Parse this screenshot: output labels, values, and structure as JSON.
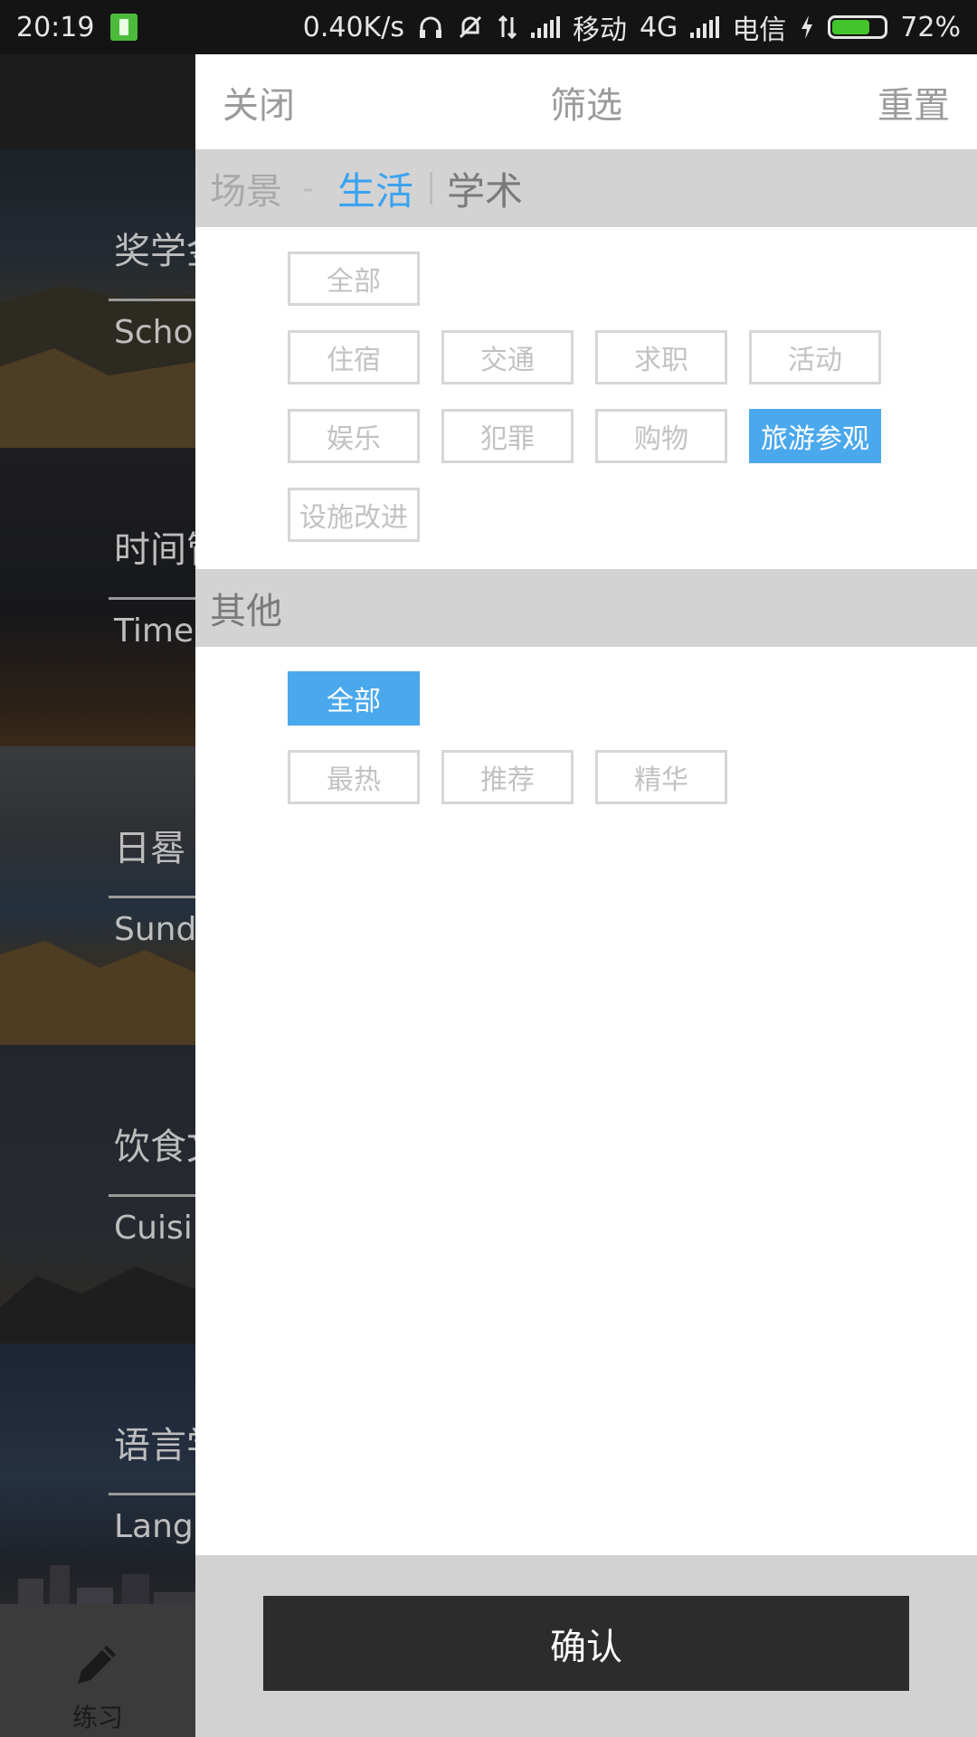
{
  "status_bar": {
    "time": "20:19",
    "net_speed": "0.40K/s",
    "carrier1": "移动",
    "network": "4G",
    "carrier2": "电信",
    "battery": "72%",
    "battery_level": 0.72,
    "icons": [
      "battery-saver-icon",
      "headphones-icon",
      "mute-icon",
      "data-arrows-icon",
      "signal-icon",
      "charging-icon"
    ]
  },
  "background": {
    "cards": [
      {
        "title": "奖学金",
        "subtitle": "Scholarship"
      },
      {
        "title": "时间管理",
        "subtitle": "Time"
      },
      {
        "title": "日晷",
        "subtitle": "Sundial"
      },
      {
        "title": "饮食文化",
        "subtitle": "Cuisine"
      },
      {
        "title": "语言学习",
        "subtitle": "Language"
      }
    ],
    "tab_label": "练习"
  },
  "drawer": {
    "close_label": "关闭",
    "title": "筛选",
    "reset_label": "重置",
    "scene": {
      "label": "场景",
      "separator": "-",
      "tab_life": "生活",
      "tab_academic": "学术",
      "tags": [
        {
          "label": "全部",
          "selected": false
        },
        {
          "label": "住宿",
          "selected": false
        },
        {
          "label": "交通",
          "selected": false
        },
        {
          "label": "求职",
          "selected": false
        },
        {
          "label": "活动",
          "selected": false
        },
        {
          "label": "娱乐",
          "selected": false
        },
        {
          "label": "犯罪",
          "selected": false
        },
        {
          "label": "购物",
          "selected": false
        },
        {
          "label": "旅游参观",
          "selected": true
        },
        {
          "label": "设施改进",
          "selected": false
        }
      ]
    },
    "other": {
      "label": "其他",
      "tags": [
        {
          "label": "全部",
          "selected": true
        },
        {
          "label": "最热",
          "selected": false
        },
        {
          "label": "推荐",
          "selected": false
        },
        {
          "label": "精华",
          "selected": false
        }
      ]
    },
    "confirm_label": "确认"
  },
  "colors": {
    "accent": "#4aa8ec",
    "tab_active": "#3aa3f0",
    "section_bg": "#d3d3d3",
    "confirm_bg": "#2c2c2c"
  }
}
